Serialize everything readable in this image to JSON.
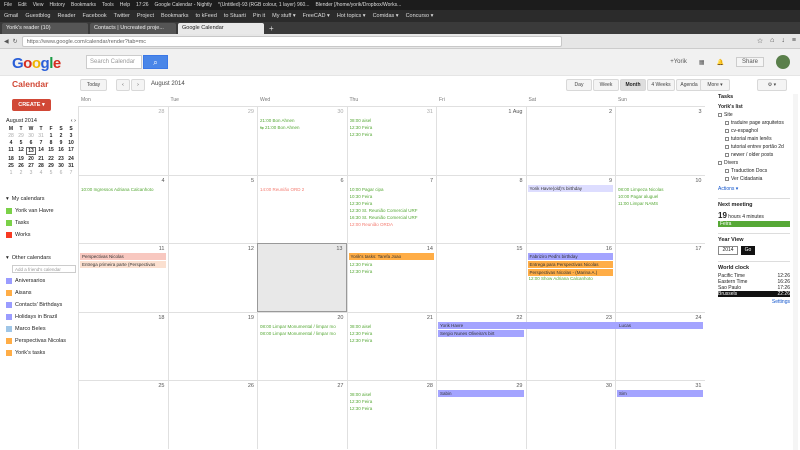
{
  "os_bar": {
    "items": [
      "File",
      "Edit",
      "View",
      "History",
      "Bookmarks",
      "Tools",
      "Help",
      "17:26",
      "Google Calendar - Nightly",
      "*(Untitled)-93 (RGB colour, 1 layer) 960...",
      "Blender [/home/yorik/Dropbox/Works..."
    ]
  },
  "bookmarks": [
    "Gmail",
    "Guestblog",
    "Reader",
    "Facebook",
    "Twitter",
    "Project",
    "Bookmarks",
    "to kFeed",
    "to Stuarti",
    "Pin it",
    "My stuff ▾",
    "FreeCAD ▾",
    "Hot topics ▾",
    "Comidas ▾",
    "Concurso ▾"
  ],
  "tabs": [
    {
      "label": "Yorik's reader (10)"
    },
    {
      "label": "Contacts | Uncreated proje..."
    },
    {
      "label": "Google Calendar"
    }
  ],
  "url": "https://www.google.com/calendar/render?tab=mc",
  "gbar": {
    "logo": "Google",
    "search_placeholder": "Search Calendar",
    "user": "+Yorik",
    "share": "Share"
  },
  "sidebar": {
    "title": "Calendar",
    "create": "CREATE",
    "mini_month": "August 2014",
    "mini_days": [
      "M",
      "T",
      "W",
      "T",
      "F",
      "S",
      "S"
    ],
    "mini_weeks": [
      [
        "28",
        "29",
        "30",
        "31",
        "1",
        "2",
        "3"
      ],
      [
        "4",
        "5",
        "6",
        "7",
        "8",
        "9",
        "10"
      ],
      [
        "11",
        "12",
        "13",
        "14",
        "15",
        "16",
        "17"
      ],
      [
        "18",
        "19",
        "20",
        "21",
        "22",
        "23",
        "24"
      ],
      [
        "25",
        "26",
        "27",
        "28",
        "29",
        "30",
        "31"
      ],
      [
        "1",
        "2",
        "3",
        "4",
        "5",
        "6",
        "7"
      ]
    ],
    "my_calendars_label": "My calendars",
    "my_calendars": [
      {
        "label": "Yorik van Havre",
        "color": "#7bd148"
      },
      {
        "label": "Tasks",
        "color": "#7bd148"
      },
      {
        "label": "Works",
        "color": "#f83a22"
      }
    ],
    "other_calendars_label": "Other calendars",
    "add_friend_placeholder": "Add a friend's calendar",
    "other_calendars": [
      {
        "label": "Aniversarios",
        "color": "#9a9cff"
      },
      {
        "label": "Aisans",
        "color": "#ffad46"
      },
      {
        "label": "Contacts' Birthdays",
        "color": "#9a9cff"
      },
      {
        "label": "Holidays in Brazil",
        "color": "#9a9cff"
      },
      {
        "label": "Marco Beles",
        "color": "#9fc6e7"
      },
      {
        "label": "Perspectivas Nicolas",
        "color": "#ffad46"
      },
      {
        "label": "Yorik's tasks",
        "color": "#ffad46"
      }
    ]
  },
  "toolbar": {
    "today": "Today",
    "prev": "‹",
    "next": "›",
    "date_label": "August 2014",
    "views": [
      "Day",
      "Week",
      "Month",
      "4 Weeks",
      "Agenda"
    ],
    "selected_view": "Month",
    "more": "More ▾",
    "settings": "⚙ ▾"
  },
  "grid": {
    "dow": [
      "Mon",
      "Tue",
      "Wed",
      "Thu",
      "Fri",
      "Sat",
      "Sun"
    ],
    "weeks": [
      [
        "28",
        "29",
        "30",
        "31",
        "1 Aug",
        "2",
        "3"
      ],
      [
        "4",
        "5",
        "6",
        "7",
        "8",
        "9",
        "10"
      ],
      [
        "11",
        "12",
        "13",
        "14",
        "15",
        "16",
        "17"
      ],
      [
        "18",
        "19",
        "20",
        "21",
        "22",
        "23",
        "24"
      ],
      [
        "25",
        "26",
        "27",
        "28",
        "29",
        "30",
        "31"
      ]
    ],
    "events": [
      {
        "w": 0,
        "d": 2,
        "row": 0,
        "text": "21:00 Bon Ahnen",
        "color": "#56a836"
      },
      {
        "w": 0,
        "d": 2,
        "row": 1,
        "text": "⇆ 21:00 Bon Ahnen",
        "color": "#56a836"
      },
      {
        "w": 0,
        "d": 3,
        "row": 0,
        "text": "08:00 aisel",
        "color": "#56a836"
      },
      {
        "w": 0,
        "d": 3,
        "row": 1,
        "text": "12:30 Feira",
        "color": "#56a836"
      },
      {
        "w": 0,
        "d": 3,
        "row": 2,
        "text": "12:30 Feira",
        "color": "#56a836"
      },
      {
        "w": 1,
        "d": 0,
        "row": 0,
        "text": "10:00 Ingressos Adriana Calcanhoto",
        "color": "#56a836"
      },
      {
        "w": 1,
        "d": 2,
        "row": 0,
        "text": "14:00 Reunião ORD 2",
        "color": "#f47b70"
      },
      {
        "w": 1,
        "d": 3,
        "row": 0,
        "text": "10:00 Pagar cipa",
        "color": "#56a836"
      },
      {
        "w": 1,
        "d": 3,
        "row": 1,
        "text": "10:30 Feira",
        "color": "#56a836"
      },
      {
        "w": 1,
        "d": 3,
        "row": 2,
        "text": "12:30 Feira",
        "color": "#56a836"
      },
      {
        "w": 1,
        "d": 3,
        "row": 3,
        "text": "12:30 St. Reunião Comercial URF",
        "color": "#56a836"
      },
      {
        "w": 1,
        "d": 3,
        "row": 4,
        "text": "16:30 St. Reunião Comercial URF",
        "color": "#56a836"
      },
      {
        "w": 1,
        "d": 3,
        "row": 5,
        "text": "12:00 Reunião ORDA",
        "color": "#f47b70"
      },
      {
        "w": 1,
        "d": 6,
        "row": 0,
        "text": "08:00 Limpeza Nicolas",
        "color": "#56a836"
      },
      {
        "w": 1,
        "d": 6,
        "row": 1,
        "text": "10:00 Pagar aluguel",
        "color": "#56a836"
      },
      {
        "w": 1,
        "d": 6,
        "row": 2,
        "text": "11:00 Limpar NAMS",
        "color": "#56a836"
      },
      {
        "w": 2,
        "d": 3,
        "row": 1,
        "text": "12:30 Feira",
        "color": "#56a836"
      },
      {
        "w": 2,
        "d": 3,
        "row": 2,
        "text": "12:30 Feira",
        "color": "#56a836"
      },
      {
        "w": 2,
        "d": 5,
        "row": 3,
        "text": "12:00 Show Adriana Calcanhoto",
        "color": "#56a836"
      },
      {
        "w": 3,
        "d": 2,
        "row": 0,
        "text": "08:00 Limpar Monumental / limpar mo",
        "color": "#56a836"
      },
      {
        "w": 3,
        "d": 2,
        "row": 1,
        "text": "08:00 Limpar Monumental / limpar mo",
        "color": "#56a836"
      },
      {
        "w": 3,
        "d": 3,
        "row": 0,
        "text": "08:00 aisel",
        "color": "#56a836"
      },
      {
        "w": 3,
        "d": 3,
        "row": 1,
        "text": "12:30 Feira",
        "color": "#56a836"
      },
      {
        "w": 3,
        "d": 3,
        "row": 2,
        "text": "12:30 Feira",
        "color": "#56a836"
      },
      {
        "w": 4,
        "d": 3,
        "row": 0,
        "text": "08:00 aisel",
        "color": "#56a836"
      },
      {
        "w": 4,
        "d": 3,
        "row": 1,
        "text": "12:30 Feira",
        "color": "#56a836"
      },
      {
        "w": 4,
        "d": 3,
        "row": 2,
        "text": "12:30 Feira",
        "color": "#56a836"
      }
    ],
    "bars": [
      {
        "w": 1,
        "d": 5,
        "span": 1,
        "row": 0,
        "text": "Yorik Havre(old)'s birthday",
        "color": "#ddddff"
      },
      {
        "w": 2,
        "d": 0,
        "span": 1,
        "row": 0,
        "text": "Perspectivas Nicolas",
        "color": "#f8c8c0"
      },
      {
        "w": 2,
        "d": 0,
        "span": 1,
        "row": 1,
        "text": "Entrega primeira parte (Perspectivas",
        "color": "#fbe0d0"
      },
      {
        "w": 2,
        "d": 3,
        "span": 1,
        "row": 0,
        "text": "Yorik's tasks: Tarefa Joao",
        "color": "#ffad46"
      },
      {
        "w": 2,
        "d": 5,
        "span": 1,
        "row": 0,
        "text": "Fabriziro Pedi's birthday",
        "color": "#a4a4ff"
      },
      {
        "w": 2,
        "d": 5,
        "span": 1,
        "row": 1,
        "text": "Entrega para Perspectivas Nicolas",
        "color": "#ffad46"
      },
      {
        "w": 2,
        "d": 5,
        "span": 1,
        "row": 2,
        "text": "Perspectivas Nicolas - (Marina A.)",
        "color": "#ffad46"
      },
      {
        "w": 3,
        "d": 4,
        "span": 3,
        "row": 0,
        "text": "Yorik Havre",
        "color": "#a4a4ff"
      },
      {
        "w": 3,
        "d": 6,
        "span": 1,
        "row": 0,
        "text": "Lucas",
        "color": "#a4a4ff"
      },
      {
        "w": 3,
        "d": 4,
        "span": 1,
        "row": 1,
        "text": "Sergio Nunes Oliveira's birt",
        "color": "#a4a4ff"
      },
      {
        "w": 4,
        "d": 4,
        "span": 1,
        "row": 0,
        "text": "Sabin",
        "color": "#a4a4ff"
      },
      {
        "w": 4,
        "d": 6,
        "span": 1,
        "row": 0,
        "text": "Sim",
        "color": "#a4a4ff"
      }
    ],
    "today": {
      "w": 2,
      "d": 2
    }
  },
  "right_panel": {
    "tasks_label": "Tasks",
    "list_title": "Yorik's list",
    "tasks": [
      {
        "text": "Site",
        "indent": 0
      },
      {
        "text": "traduire page arquitetos",
        "indent": 1
      },
      {
        "text": "cv-espaghol",
        "indent": 1
      },
      {
        "text": "tutorial main lenês",
        "indent": 1
      },
      {
        "text": "tutorial entrev portão 2d",
        "indent": 1
      },
      {
        "text": "newer / older posts",
        "indent": 1
      },
      {
        "text": "Divers",
        "indent": 0
      },
      {
        "text": "Traduction Docs",
        "indent": 1
      },
      {
        "text": "Ver Cidadania",
        "indent": 1
      }
    ],
    "actions": "Actions ▾",
    "next_meeting_label": "Next meeting",
    "next_meeting_hours": "19",
    "next_meeting_rest": "hours 4 minutes",
    "next_meeting_event": "Feira",
    "year_view_label": "Year View",
    "year_value": "2014",
    "year_go": "Go",
    "world_clock_label": "World clock",
    "clocks": [
      {
        "city": "Pacific Time",
        "time": "12:26"
      },
      {
        "city": "Eastern Time",
        "time": "16:26"
      },
      {
        "city": "Sao Paulo",
        "time": "17:26"
      },
      {
        "city": "Brussels",
        "time": "22:26"
      }
    ],
    "settings_link": "Settings"
  }
}
